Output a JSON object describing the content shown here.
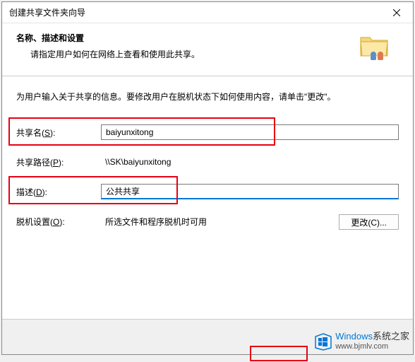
{
  "titlebar": {
    "title": "创建共享文件夹向导"
  },
  "header": {
    "title": "名称、描述和设置",
    "subtitle": "请指定用户如何在网络上查看和使用此共享。"
  },
  "instruction": "为用户输入关于共享的信息。要修改用户在脱机状态下如何使用内容，请单击\"更改\"。",
  "form": {
    "share_name_label": "共享名(S):",
    "share_name_value": "baiyunxitong",
    "share_path_label": "共享路径(P):",
    "share_path_value": "\\\\SK\\baiyunxitong",
    "description_label": "描述(D):",
    "description_value": "公共共享",
    "offline_label": "脱机设置(O):",
    "offline_value": "所选文件和程序脱机时可用"
  },
  "buttons": {
    "change": "更改(C)..."
  },
  "watermark": {
    "brand": "Windows",
    "suffix": "系统之家",
    "url": "www.bjmlv.com"
  }
}
